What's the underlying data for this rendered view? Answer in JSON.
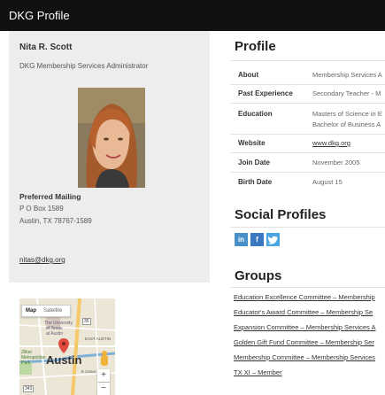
{
  "window": {
    "title": "DKG Profile"
  },
  "member": {
    "name": "Nita R. Scott",
    "role": "DKG Membership Services Administrator",
    "preferred_mailing_label": "Preferred Mailing",
    "address": [
      "P O Box 1589",
      "Austin, TX 78767-1589"
    ],
    "email": "nitas@dkg.org"
  },
  "map": {
    "tab_map": "Map",
    "tab_satellite": "Satellite",
    "labels": [
      "The University",
      "of Texas",
      "at Austin",
      "EAST AUSTIN",
      "Austin",
      "E Cesar",
      "Zilker",
      "Metropolitan",
      "Park",
      "343",
      "35"
    ],
    "zoom_in": "+",
    "zoom_out": "−"
  },
  "profile": {
    "heading": "Profile",
    "rows": [
      {
        "label": "About",
        "value": "Membership Services A"
      },
      {
        "label": "Past Experience",
        "value": "Secondary Teacher - M"
      },
      {
        "label": "Education",
        "value": "Masters of Science in E",
        "value2": "Bachelor of Business A"
      },
      {
        "label": "Website",
        "value": "www.dkg.org"
      },
      {
        "label": "Join Date",
        "value": "November 2005"
      },
      {
        "label": "Birth Date",
        "value": "August 15"
      }
    ]
  },
  "social": {
    "heading": "Social Profiles",
    "icons": [
      {
        "text": "in",
        "color": "#4a90c8"
      },
      {
        "text": "f",
        "color": "#3b78c2"
      },
      {
        "text": "",
        "color": "#49a5e3"
      }
    ]
  },
  "groups": {
    "heading": "Groups",
    "items": [
      "Education Excellence Committee – Membership",
      "Educator's Award Committee – Membership Se",
      "Expansion Committee – Membership Services A",
      "Golden Gift Fund Committee – Membership Ser",
      "Membership Committee – Membership Services",
      "TX XI – Member"
    ]
  }
}
